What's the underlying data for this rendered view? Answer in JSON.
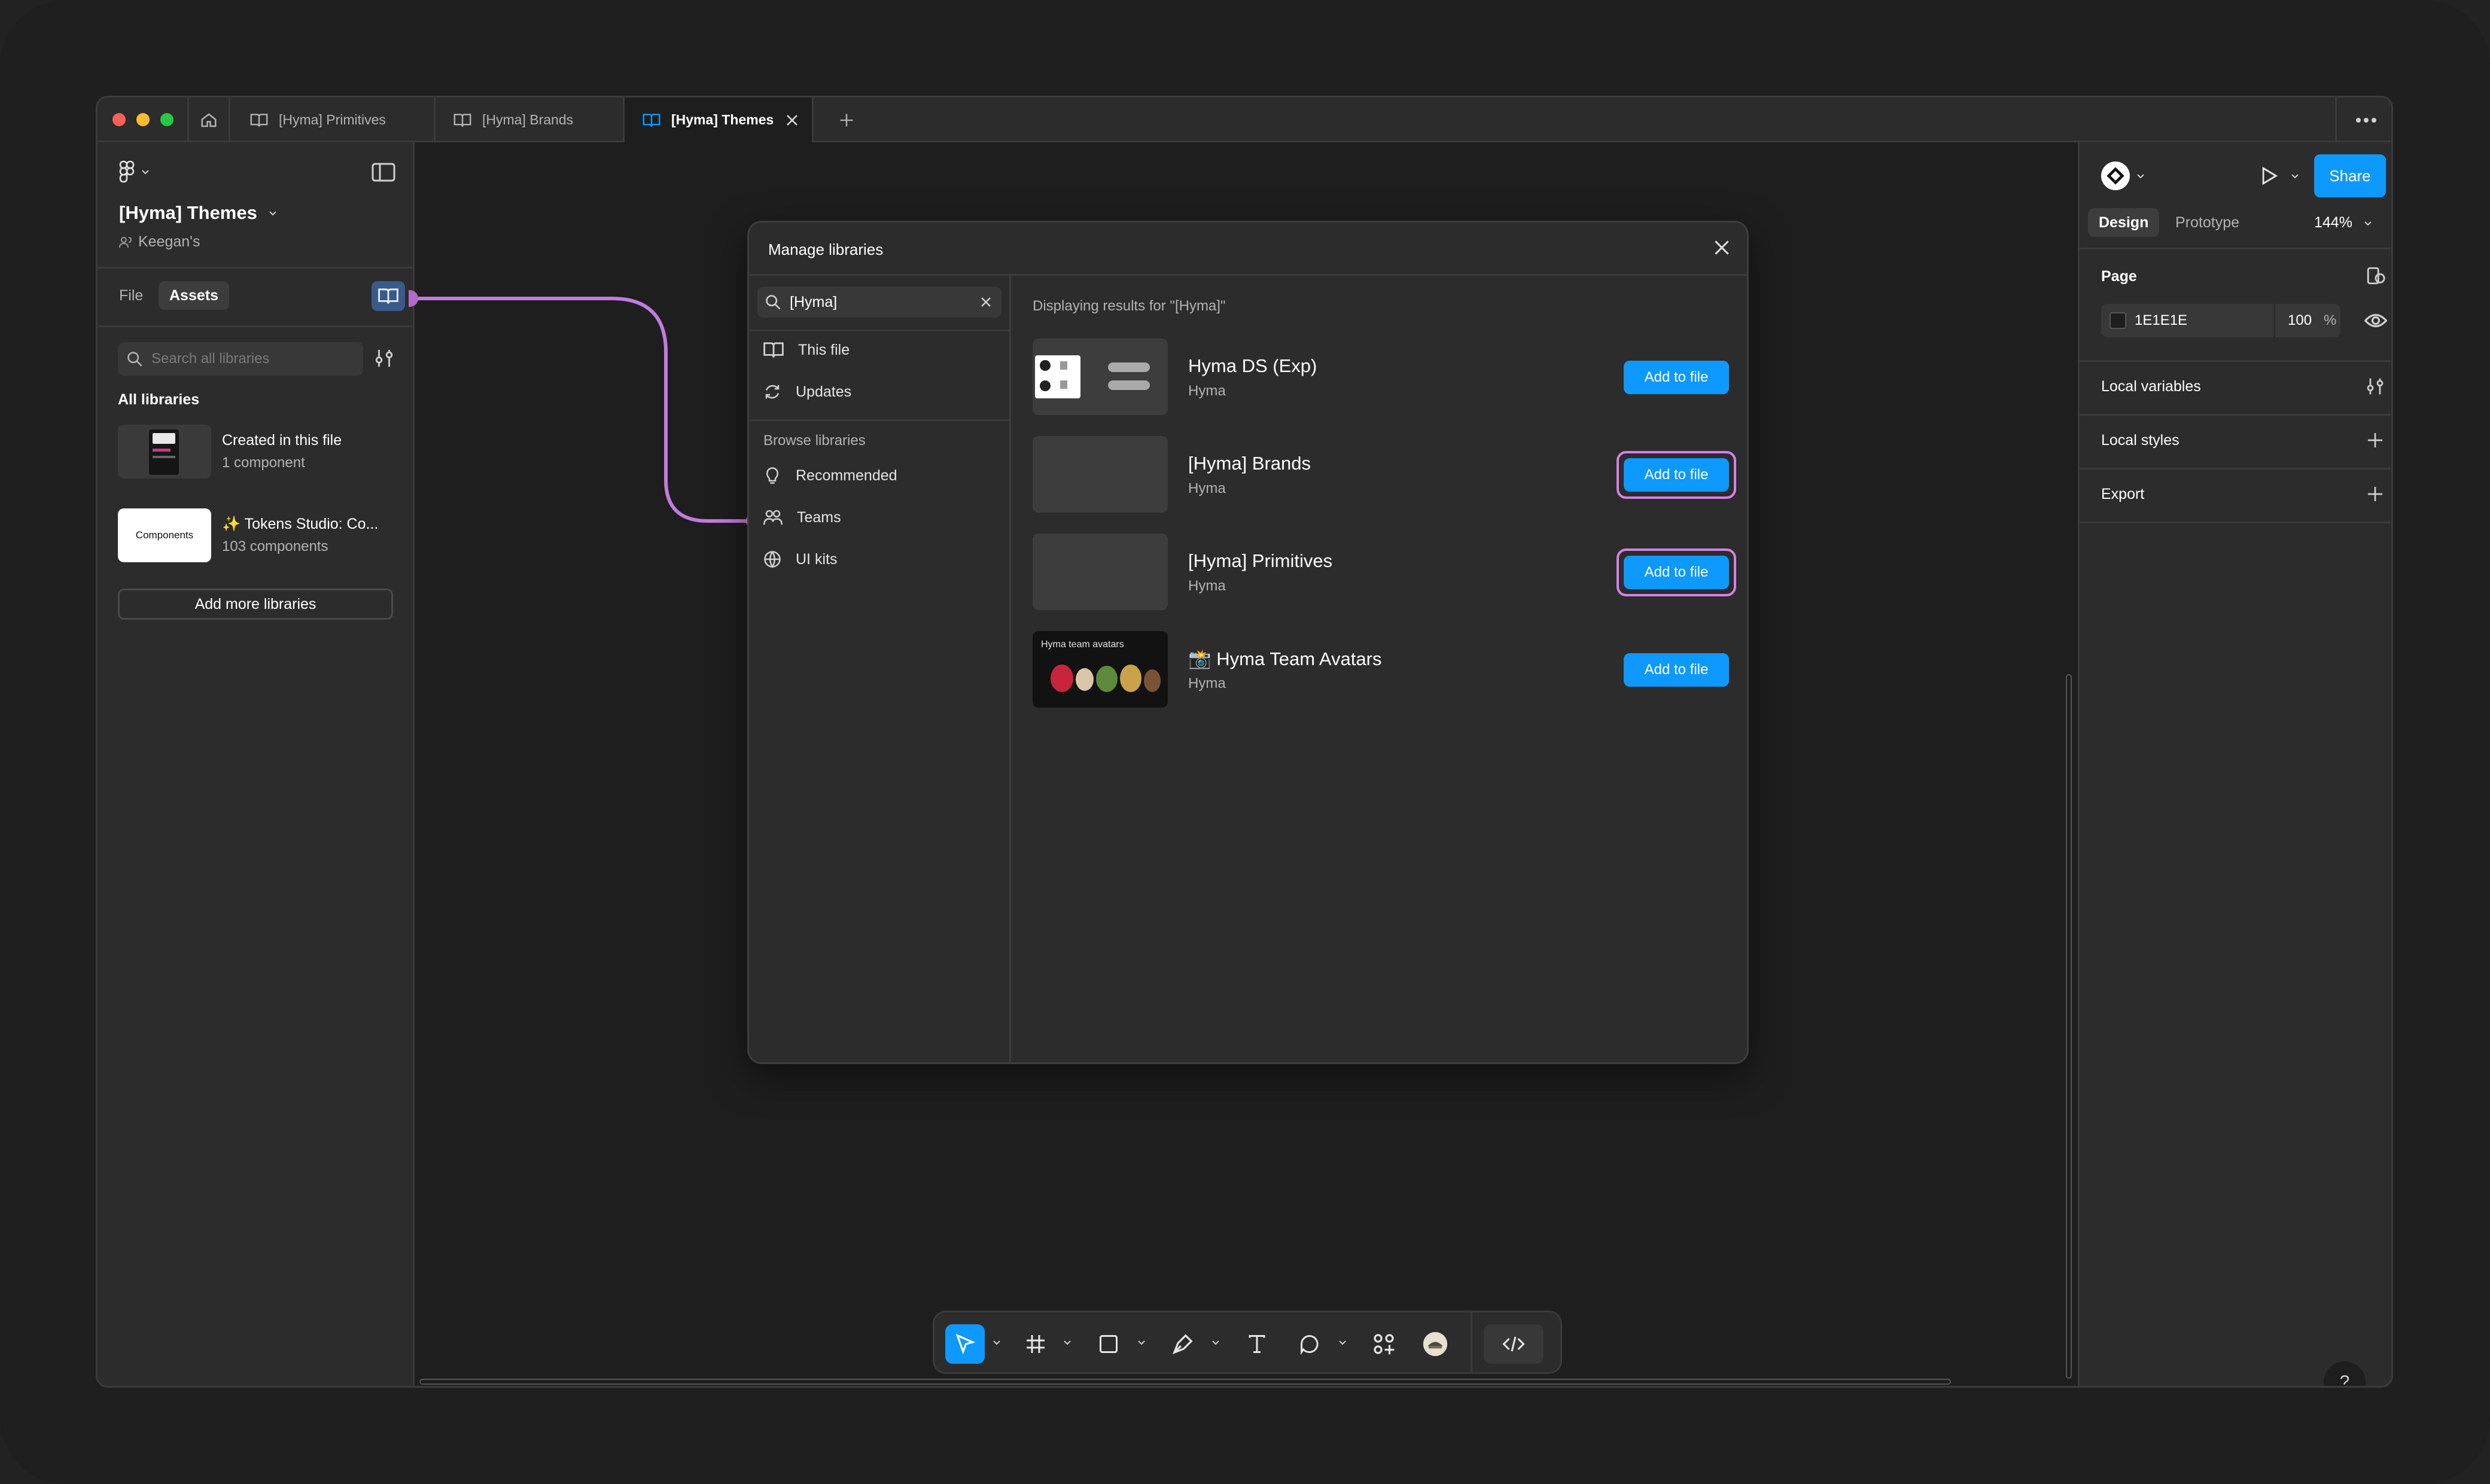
{
  "tabs": [
    {
      "label": "[Hyma] Primitives"
    },
    {
      "label": "[Hyma] Brands"
    },
    {
      "label": "[Hyma] Themes"
    }
  ],
  "left_panel": {
    "file_name": "[Hyma] Themes",
    "team": "Keegan's",
    "tab_file": "File",
    "tab_assets": "Assets",
    "search_placeholder": "Search all libraries",
    "section_title": "All libraries",
    "libraries": [
      {
        "name": "Created in this file",
        "count": "1 component"
      },
      {
        "name": "✨ Tokens Studio: Co...",
        "count": "103 components",
        "thumb_title": "Components"
      }
    ],
    "add_more": "Add more libraries"
  },
  "modal": {
    "title": "Manage libraries",
    "search_value": "[Hyma]",
    "nav": [
      {
        "label": "This file",
        "icon": "book-icon"
      },
      {
        "label": "Updates",
        "icon": "refresh-icon"
      }
    ],
    "browse_title": "Browse libraries",
    "browse": [
      {
        "label": "Recommended",
        "icon": "lightbulb-icon"
      },
      {
        "label": "Teams",
        "icon": "people-icon"
      },
      {
        "label": "UI kits",
        "icon": "globe-icon"
      }
    ],
    "results_label": "Displaying results for \"[Hyma]\"",
    "results": [
      {
        "name": "Hyma DS (Exp)",
        "owner": "Hyma",
        "action": "Add to file",
        "highlighted": false
      },
      {
        "name": "[Hyma] Brands",
        "owner": "Hyma",
        "action": "Add to file",
        "highlighted": true
      },
      {
        "name": "[Hyma] Primitives",
        "owner": "Hyma",
        "action": "Add to file",
        "highlighted": true
      },
      {
        "name": "📸 Hyma Team Avatars",
        "owner": "Hyma",
        "action": "Add to file",
        "highlighted": false,
        "thumb_title": "Hyma team avatars"
      }
    ]
  },
  "right_panel": {
    "share": "Share",
    "tab_design": "Design",
    "tab_prototype": "Prototype",
    "zoom": "144%",
    "page_title": "Page",
    "page_color": "1E1E1E",
    "page_opacity": "100",
    "percent": "%",
    "local_variables": "Local variables",
    "local_styles": "Local styles",
    "export": "Export"
  },
  "help": "?",
  "colors": {
    "accent": "#0d99ff",
    "highlight": "#d580e8",
    "window_bg": "#1e1e1e",
    "panel_bg": "#2c2c2c"
  }
}
